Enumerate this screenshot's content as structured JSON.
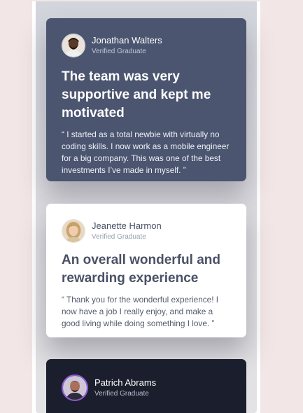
{
  "testimonials": [
    {
      "name": "Jonathan Walters",
      "role": "Verified Graduate",
      "headline": "The team was very supportive and kept me motivated",
      "quote": "“ I started as a total newbie with virtually no coding skills. I now work as a mobile engineer for a big company. This was one of the best investments I’ve made in myself. ”"
    },
    {
      "name": "Jeanette Harmon",
      "role": "Verified Graduate",
      "headline": "An overall wonderful and rewarding experience",
      "quote": "“ Thank you for the wonderful experience! I now have a job I really enjoy, and make a good living while doing something I love. ”"
    },
    {
      "name": "Patrich Abrams",
      "role": "Verified Graduate"
    }
  ],
  "colors": {
    "page_background": "#f3e6e6",
    "card_dark_blue": "#4b5570",
    "card_white": "#ffffff",
    "card_dark": "#1b1e2c",
    "avatar_ring_purple": "#8f5bd9"
  }
}
